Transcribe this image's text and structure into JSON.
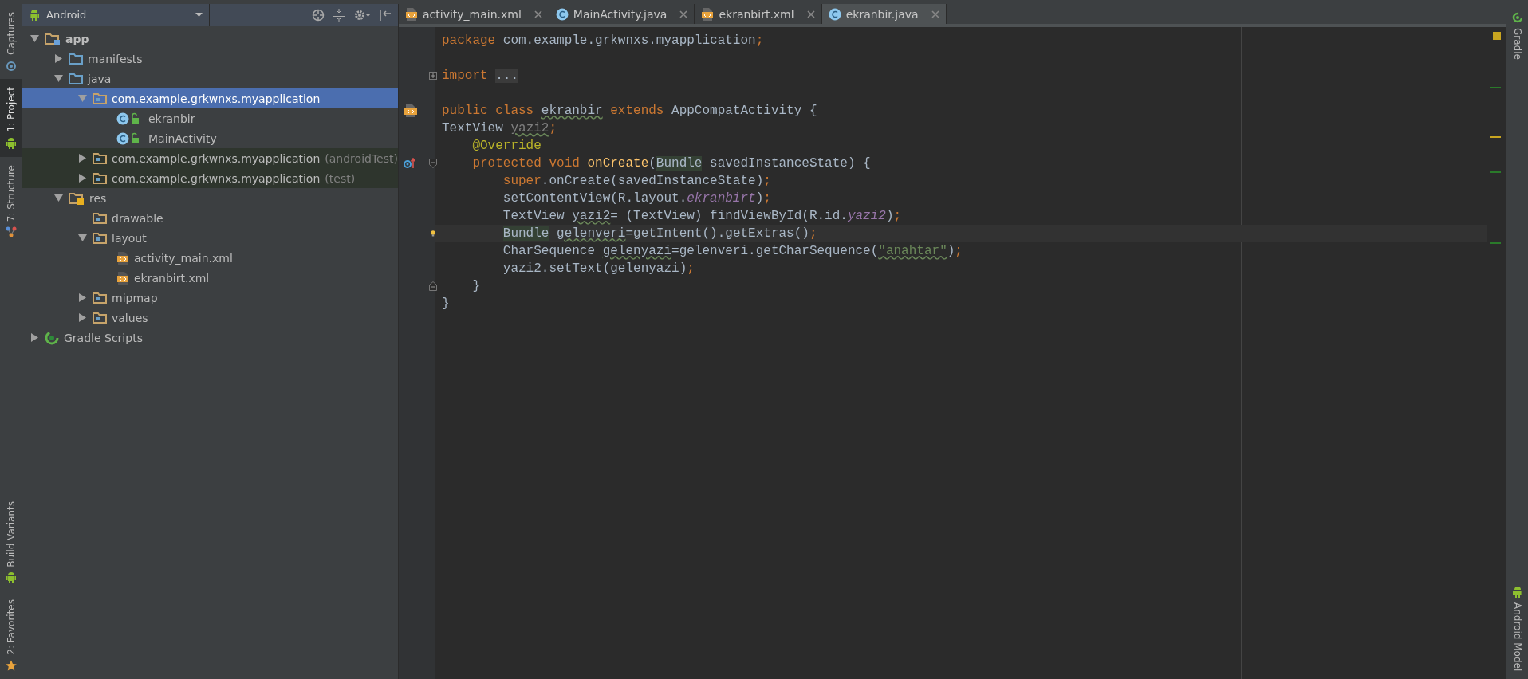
{
  "left_tool_strip": [
    {
      "label": "Captures",
      "kind": "capture",
      "selected": false
    },
    {
      "label": "1: Project",
      "kind": "android",
      "selected": true
    },
    {
      "label": "7: Structure",
      "kind": "structure",
      "selected": false
    }
  ],
  "left_tool_strip_bottom": [
    {
      "label": "Build Variants",
      "kind": "android",
      "selected": false
    },
    {
      "label": "2: Favorites",
      "kind": "star",
      "selected": false
    }
  ],
  "project_panel": {
    "view": "Android",
    "tree": [
      {
        "label": "app",
        "kind": "module",
        "expanded": true,
        "selected": false,
        "test_scope": false,
        "children": [
          {
            "label": "manifests",
            "kind": "folder",
            "expanded": false,
            "selected": false,
            "test_scope": false
          },
          {
            "label": "java",
            "kind": "folder",
            "expanded": true,
            "selected": false,
            "test_scope": false,
            "children": [
              {
                "label": "com.example.grkwnxs.myapplication",
                "kind": "package",
                "expanded": true,
                "selected": true,
                "test_scope": false,
                "children": [
                  {
                    "label": "ekranbir",
                    "kind": "class",
                    "selected": false,
                    "test_scope": false
                  },
                  {
                    "label": "MainActivity",
                    "kind": "class",
                    "selected": false,
                    "test_scope": false
                  }
                ]
              },
              {
                "label": "com.example.grkwnxs.myapplication",
                "suffix": "(androidTest)",
                "kind": "package",
                "expanded": false,
                "selected": false,
                "test_scope": true
              },
              {
                "label": "com.example.grkwnxs.myapplication",
                "suffix": "(test)",
                "kind": "package",
                "expanded": false,
                "selected": false,
                "test_scope": true
              }
            ]
          },
          {
            "label": "res",
            "kind": "res",
            "expanded": true,
            "selected": false,
            "test_scope": false,
            "children": [
              {
                "label": "drawable",
                "kind": "package",
                "selected": false,
                "test_scope": false
              },
              {
                "label": "layout",
                "kind": "package",
                "expanded": true,
                "selected": false,
                "test_scope": false,
                "children": [
                  {
                    "label": "activity_main.xml",
                    "kind": "xml",
                    "selected": false,
                    "test_scope": false
                  },
                  {
                    "label": "ekranbirt.xml",
                    "kind": "xml",
                    "selected": false,
                    "test_scope": false
                  }
                ]
              },
              {
                "label": "mipmap",
                "kind": "package",
                "expanded": false,
                "selected": false,
                "test_scope": false
              },
              {
                "label": "values",
                "kind": "package",
                "expanded": false,
                "selected": false,
                "test_scope": false
              }
            ]
          }
        ]
      },
      {
        "label": "Gradle Scripts",
        "kind": "gradle",
        "expanded": false,
        "selected": false,
        "test_scope": false
      }
    ]
  },
  "editor_tabs": [
    {
      "label": "activity_main.xml",
      "kind": "xml",
      "selected": false
    },
    {
      "label": "MainActivity.java",
      "kind": "class",
      "selected": false
    },
    {
      "label": "ekranbirt.xml",
      "kind": "xml",
      "selected": false
    },
    {
      "label": "ekranbir.java",
      "kind": "class",
      "selected": true
    }
  ],
  "code_lines": [
    {
      "kind": "code",
      "current": false,
      "tokens": [
        {
          "kind": "keyword",
          "text": "package "
        },
        {
          "kind": "plain",
          "text": "com.example.grkwnxs.myapplication"
        },
        {
          "kind": "keyword",
          "text": ";"
        }
      ]
    },
    {
      "kind": "blank",
      "current": false
    },
    {
      "kind": "code",
      "current": false,
      "fold": {
        "kind": "plus"
      },
      "tokens": [
        {
          "kind": "keyword",
          "text": "import "
        },
        {
          "kind": "folded",
          "text": "..."
        }
      ]
    },
    {
      "kind": "blank",
      "current": false
    },
    {
      "kind": "code",
      "current": false,
      "gutter": {
        "kind": "layout"
      },
      "tokens": [
        {
          "kind": "keyword",
          "text": "public class "
        },
        {
          "kind": "typo",
          "text": "ekranbir"
        },
        {
          "kind": "keyword",
          "text": " extends "
        },
        {
          "kind": "plain",
          "text": "AppCompatActivity {"
        }
      ]
    },
    {
      "kind": "code",
      "current": false,
      "tokens": [
        {
          "kind": "plain",
          "text": "TextView "
        },
        {
          "kind": "unused",
          "text": "yazi2"
        },
        {
          "kind": "keyword",
          "text": ";"
        }
      ]
    },
    {
      "kind": "code",
      "current": false,
      "tokens": [
        {
          "kind": "annotation",
          "text": "    @Override"
        }
      ]
    },
    {
      "kind": "code",
      "current": false,
      "gutter": {
        "kind": "override"
      },
      "fold": {
        "kind": "minus"
      },
      "tokens": [
        {
          "kind": "keyword",
          "text": "    protected void "
        },
        {
          "kind": "method",
          "text": "onCreate"
        },
        {
          "kind": "plain",
          "text": "("
        },
        {
          "kind": "marked",
          "text": "Bundle"
        },
        {
          "kind": "plain",
          "text": " savedInstanceState) {"
        }
      ]
    },
    {
      "kind": "code",
      "current": false,
      "tokens": [
        {
          "kind": "keyword",
          "text": "        super"
        },
        {
          "kind": "plain",
          "text": ".onCreate(savedInstanceState)"
        },
        {
          "kind": "keyword",
          "text": ";"
        }
      ]
    },
    {
      "kind": "code",
      "current": false,
      "tokens": [
        {
          "kind": "plain",
          "text": "        setContentView(R.layout."
        },
        {
          "kind": "field",
          "text": "ekranbirt"
        },
        {
          "kind": "plain",
          "text": ")"
        },
        {
          "kind": "keyword",
          "text": ";"
        }
      ]
    },
    {
      "kind": "code",
      "current": false,
      "tokens": [
        {
          "kind": "plain",
          "text": "        TextView "
        },
        {
          "kind": "typo",
          "text": "yazi2"
        },
        {
          "kind": "plain",
          "text": "= (TextView) findViewById(R.id."
        },
        {
          "kind": "field",
          "text": "yazi2"
        },
        {
          "kind": "plain",
          "text": ")"
        },
        {
          "kind": "keyword",
          "text": ";"
        }
      ]
    },
    {
      "kind": "code",
      "current": true,
      "gutter": {
        "kind": "bulb"
      },
      "tokens": [
        {
          "kind": "marked",
          "text": "        Bundle"
        },
        {
          "kind": "typo",
          "text": " gelenveri"
        },
        {
          "kind": "plain",
          "text": "=getIntent().getExtras()"
        },
        {
          "kind": "keyword",
          "text": ";"
        }
      ]
    },
    {
      "kind": "code",
      "current": false,
      "tokens": [
        {
          "kind": "plain",
          "text": "        CharSequence "
        },
        {
          "kind": "typo",
          "text": "gelenyazi"
        },
        {
          "kind": "plain",
          "text": "=gelenveri.getCharSequence("
        },
        {
          "kind": "string",
          "text": "\"anahtar\""
        },
        {
          "kind": "plain",
          "text": ")"
        },
        {
          "kind": "keyword",
          "text": ";"
        }
      ]
    },
    {
      "kind": "code",
      "current": false,
      "tokens": [
        {
          "kind": "plain",
          "text": "        yazi2.setText(gelenyazi)"
        },
        {
          "kind": "keyword",
          "text": ";"
        }
      ]
    },
    {
      "kind": "code",
      "current": false,
      "fold": {
        "kind": "end"
      },
      "tokens": [
        {
          "kind": "plain",
          "text": "    }"
        }
      ]
    },
    {
      "kind": "code",
      "current": false,
      "tokens": [
        {
          "kind": "plain",
          "text": "}"
        }
      ]
    }
  ],
  "right_tool_strip": [
    {
      "label": "Gradle",
      "kind": "gradle",
      "selected": false
    }
  ],
  "right_tool_strip_bottom": [
    {
      "label": "Android Model",
      "kind": "android",
      "selected": false
    }
  ]
}
